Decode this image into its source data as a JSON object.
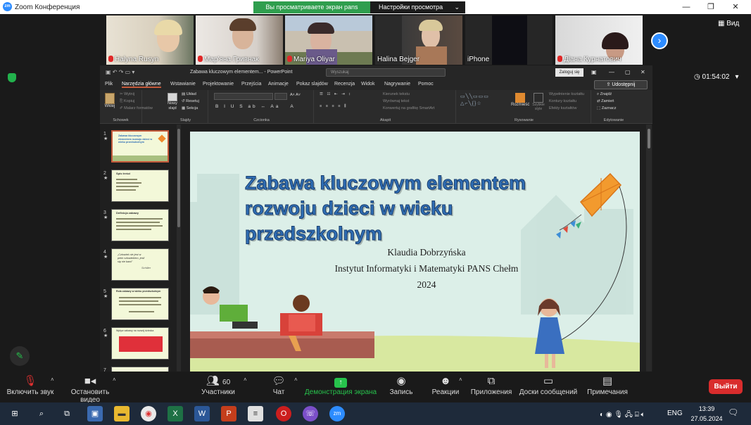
{
  "zoom": {
    "window_title": "Zoom Конференция",
    "logo_text": "zm",
    "share_banner": "Вы просматриваете экран pans",
    "view_options": "Настройки просмотра",
    "view_button": "Вид",
    "timer": "01:54:02",
    "participants": [
      {
        "name": "Halyna Rusyn",
        "muted": true
      },
      {
        "name": "Мар'яна Гривнак",
        "muted": true
      },
      {
        "name": "Mariya Oliyar",
        "muted": true
      },
      {
        "name": "Halina Bejger",
        "muted": false
      },
      {
        "name": "iPhone",
        "muted": false
      },
      {
        "name": "Діана Курнатович",
        "muted": true
      }
    ],
    "toolbar": {
      "mute": "Включить звук",
      "video": "Остановить видео",
      "participants": "Участники",
      "participants_count": "60",
      "chat": "Чат",
      "share": "Демонстрация экрана",
      "record": "Запись",
      "reactions": "Реакции",
      "apps": "Приложения",
      "whiteboards": "Доски сообщений",
      "notes": "Примечания",
      "leave": "Выйти"
    }
  },
  "powerpoint": {
    "file_title": "Zabawa kluczowym elementem...  -  PowerPoint",
    "search_placeholder": "Wyszukaj",
    "login_button": "Zaloguj się",
    "share_button": "Udostępnij",
    "tabs": [
      "Plik",
      "Narzędzia główne",
      "Wstawianie",
      "Projektowanie",
      "Przejścia",
      "Animacje",
      "Pokaz slajdów",
      "Recenzja",
      "Widok",
      "Nagrywanie",
      "Pomoc"
    ],
    "active_tab": "Narzędzia główne",
    "ribbon": {
      "paste": "Wklej",
      "cut": "Wytnij",
      "copy": "Kopiuj",
      "format_painter": "Malarz formatów",
      "clipboard_group": "Schowek",
      "new_slide": "Nowy slajd",
      "layout": "Układ",
      "reset": "Resetuj",
      "section": "Sekcja",
      "slides_group": "Slajdy",
      "font_group": "Czcionka",
      "text_direction": "Kierunek tekstu",
      "align_text": "Wyrównaj tekst",
      "smartart": "Konwertuj na grafikę SmartArt",
      "paragraph_group": "Akapit",
      "arrange": "Rozmieść",
      "quick_styles": "Szybkie style",
      "shape_fill": "Wypełnienie kształtu",
      "shape_outline": "Kontury kształtu",
      "shape_effects": "Efekty kształtów",
      "drawing_group": "Rysowanie",
      "find": "Znajdź",
      "replace": "Zamień",
      "select": "Zaznacz",
      "editing_group": "Edytowanie"
    },
    "thumbnails": [
      {
        "num": "1",
        "star": "★",
        "text": "Zabawa kluczowym elementem rozwoju dzieci w wieku przedszkolnym"
      },
      {
        "num": "2",
        "star": "★",
        "text": "Spis treści"
      },
      {
        "num": "3",
        "star": "★",
        "text": "Definicja zabawy"
      },
      {
        "num": "4",
        "star": "★",
        "text": "„Człowiek nie jest w pełni człowiekiem, jeśli się nie bawi”",
        "sub": "Schiller"
      },
      {
        "num": "5",
        "star": "★",
        "text": "Rola zabawy w wieku przedszkolnym"
      },
      {
        "num": "6",
        "star": "★",
        "text": "Wpływ zabawy na rozwój dziecka"
      },
      {
        "num": "7",
        "star": "",
        "text": ""
      }
    ],
    "slide": {
      "title": "Zabawa kluczowym elementem rozwoju dzieci w wieku przedszkolnym",
      "title_lines": [
        "Zabawa kluczowym elementem",
        "rozwoju dzieci w wieku",
        "przedszkolnym"
      ],
      "author": "Klaudia Dobrzyńska",
      "institute": "Instytut Informatyki i Matematyki PANS Chełm",
      "year": "2024"
    }
  },
  "taskbar": {
    "lang": "ENG",
    "time": "13:39",
    "date": "27.05.2024"
  }
}
